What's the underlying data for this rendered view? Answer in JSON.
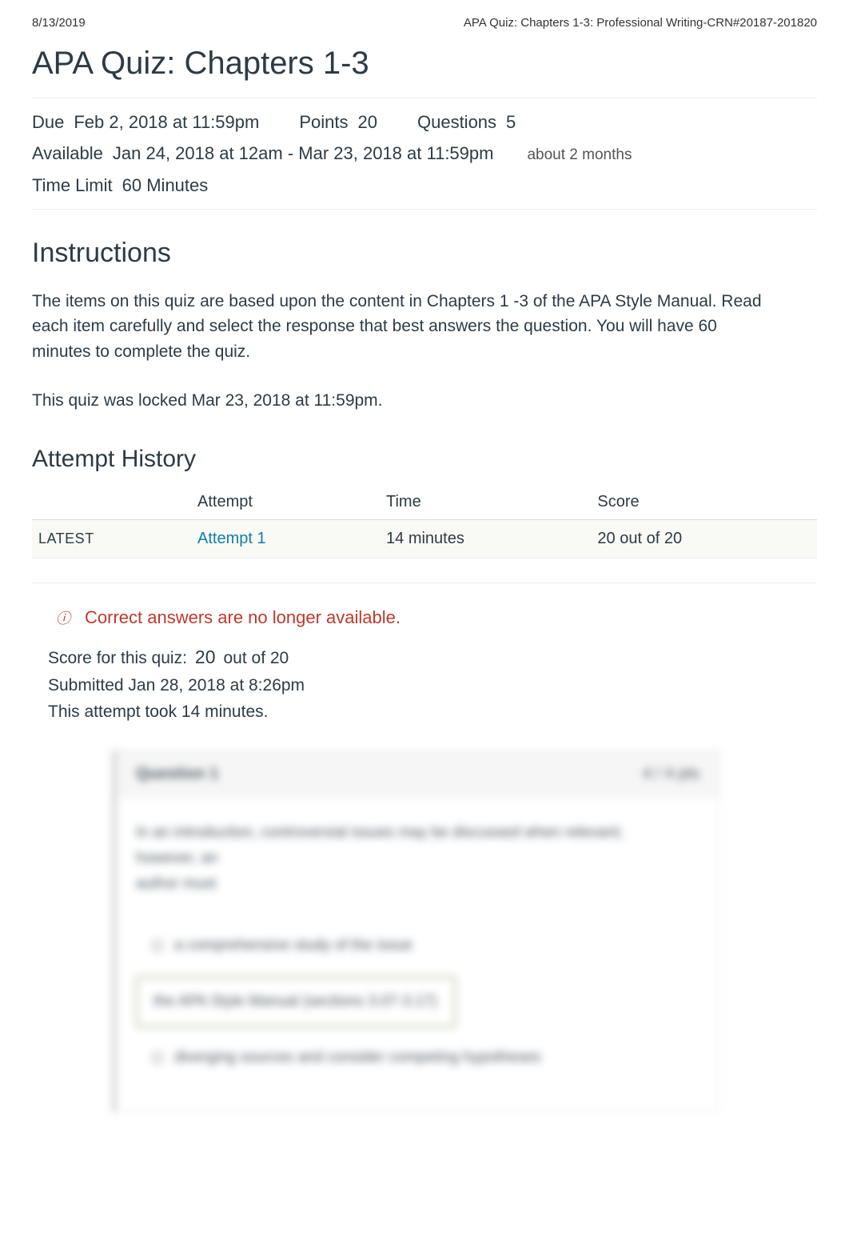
{
  "header": {
    "date": "8/13/2019",
    "breadcrumb": "APA Quiz: Chapters 1-3: Professional Writing-CRN#20187-201820"
  },
  "title": "APA Quiz: Chapters 1-3",
  "meta": {
    "due_label": "Due",
    "due_value": "Feb 2, 2018 at 11:59pm",
    "points_label": "Points",
    "points_value": "20",
    "questions_label": "Questions",
    "questions_value": "5",
    "available_label": "Available",
    "available_value": "Jan 24, 2018 at 12am - Mar 23, 2018 at 11:59pm",
    "available_note": "about 2 months",
    "timelimit_label": "Time Limit",
    "timelimit_value": "60 Minutes"
  },
  "instructions": {
    "heading": "Instructions",
    "body": "The items on this quiz are based upon the content in Chapters 1 -3 of the APA Style Manual. Read each item carefully and select the response that best answers the question. You will have 60 minutes to complete the quiz.",
    "locked": "This quiz was locked Mar 23, 2018 at 11:59pm."
  },
  "history": {
    "heading": "Attempt History",
    "columns": {
      "c0": "",
      "c1": "Attempt",
      "c2": "Time",
      "c3": "Score"
    },
    "row": {
      "latest": "LATEST",
      "attempt": "Attempt 1",
      "time": "14 minutes",
      "score": "20 out of 20"
    }
  },
  "notice": {
    "text": "Correct answers are no longer available."
  },
  "score": {
    "label": "Score for this quiz:",
    "value": "20",
    "outof": "out of 20",
    "submitted": "Submitted Jan 28, 2018 at 8:26pm",
    "duration": "This attempt took 14 minutes."
  },
  "question": {
    "title": "Question 1",
    "points": "4 / 4 pts",
    "prompt1": "In an introduction, controversial issues may be discussed when relevant;",
    "prompt2": "however, an",
    "prompt3": "author must",
    "opt1": "a comprehensive study of the issue",
    "opt2": "the APA Style Manual (sections 3.07-3.17)",
    "opt3": "diverging sources and consider competing hypotheses"
  }
}
